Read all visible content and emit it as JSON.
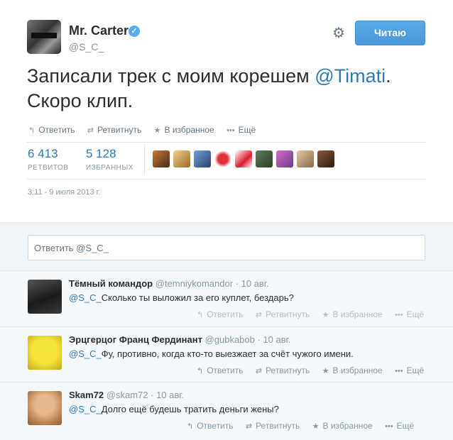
{
  "tweet": {
    "author_name": "Mr. Carter",
    "author_handle": "@S_C_",
    "follow_label": "Читаю",
    "text_before": "Записали трек с моим корешем ",
    "text_mention": "@Timati",
    "text_after": ". Скоро клип.",
    "actions": {
      "reply": "Ответить",
      "retweet": "Ретвитнуть",
      "favorite": "В избранное",
      "more": "Ещё"
    },
    "stats": {
      "retweets_count": "6 413",
      "retweets_label": "РЕТВИТОВ",
      "favorites_count": "5 128",
      "favorites_label": "ИЗБРАННЫХ"
    },
    "timestamp": "3:11 - 9 июля 2013 г."
  },
  "reply_box": {
    "placeholder_prefix": "Ответить ",
    "placeholder_mention": "@S_C_"
  },
  "replies": [
    {
      "name": "Тёмный командор",
      "handle": "@temniykomandor",
      "sep": " · ",
      "date": "10 авг.",
      "mention": "@S_C_",
      "text": "Сколько ты выложил за его куплет, бездарь?"
    },
    {
      "name": "Эрцгерцог Франц Фердинант",
      "handle": "@gubkabob",
      "sep": " · ",
      "date": "10 авг.",
      "mention": "@S_C_",
      "text": "Фу, противно, когда кто-то выезжает за счёт чужого имени."
    },
    {
      "name": "Skam72",
      "handle": "@skam72",
      "sep": " · ",
      "date": "10 авг.",
      "mention": "@S_C_",
      "text": "Долго ещё будешь тратить деньги жены?"
    }
  ],
  "reply_actions": {
    "reply": "Ответить",
    "retweet": "Ретвитнуть",
    "favorite": "В избранное",
    "more": "Ещё"
  },
  "icons": {
    "verified": "verified-badge-icon",
    "gear": "gear-icon",
    "reply": "reply-arrow-icon",
    "retweet": "retweet-icon",
    "favorite": "star-icon",
    "more": "more-dots-icon"
  },
  "colors": {
    "accent": "#55acee",
    "link": "#2b7bb9",
    "muted": "#8899a6"
  }
}
